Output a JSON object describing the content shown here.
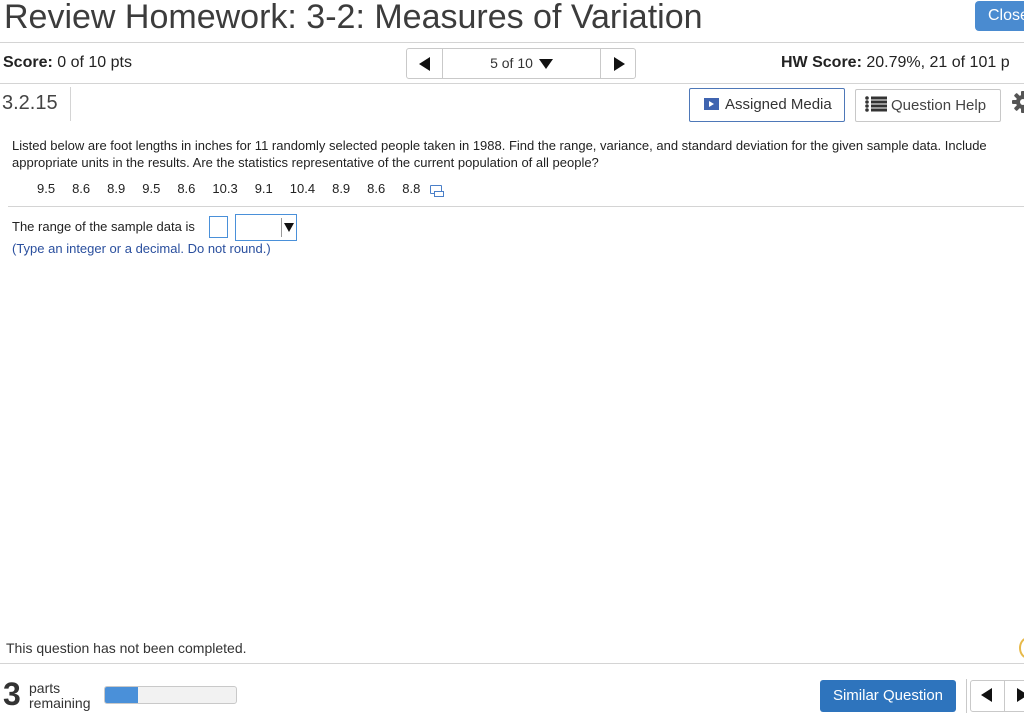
{
  "header": {
    "title": "Review Homework: 3-2: Measures of Variation",
    "close_label": "Close"
  },
  "score_bar": {
    "score_label": "Score:",
    "score_value": "0 of 10 pts",
    "question_nav": "5 of 10",
    "hw_score_label": "HW Score:",
    "hw_score_value": "20.79%, 21 of 101 p"
  },
  "question": {
    "number": "3.2.15",
    "assigned_media_label": "Assigned Media",
    "question_help_label": "Question Help",
    "text": "Listed below are foot lengths in inches for 11 randomly selected people taken in 1988. Find the range, variance, and standard deviation for the given sample data. Include appropriate units in the results. Are the statistics representative of the current population of all people?",
    "data_values": [
      "9.5",
      "8.6",
      "8.9",
      "9.5",
      "8.6",
      "10.3",
      "9.1",
      "10.4",
      "8.9",
      "8.6",
      "8.8"
    ],
    "answer_prompt": "The range of the sample data is",
    "answer_value": "",
    "unit_selected": "",
    "hint": "(Type an integer or a decimal. Do not round.)"
  },
  "footer": {
    "status": "This question has not been completed.",
    "parts_count": "3",
    "parts_label_1": "parts",
    "parts_label_2": "remaining",
    "progress_fraction": 0.25,
    "similar_question_label": "Similar Question"
  },
  "colors": {
    "primary_button": "#2e74bd",
    "close_button": "#4a8bd0",
    "hint_text": "#2a4f9e",
    "input_border": "#4a90d9"
  },
  "icons": {
    "media": "video-icon",
    "help": "list-icon",
    "settings": "gear-icon",
    "copy": "copy-data-icon"
  }
}
